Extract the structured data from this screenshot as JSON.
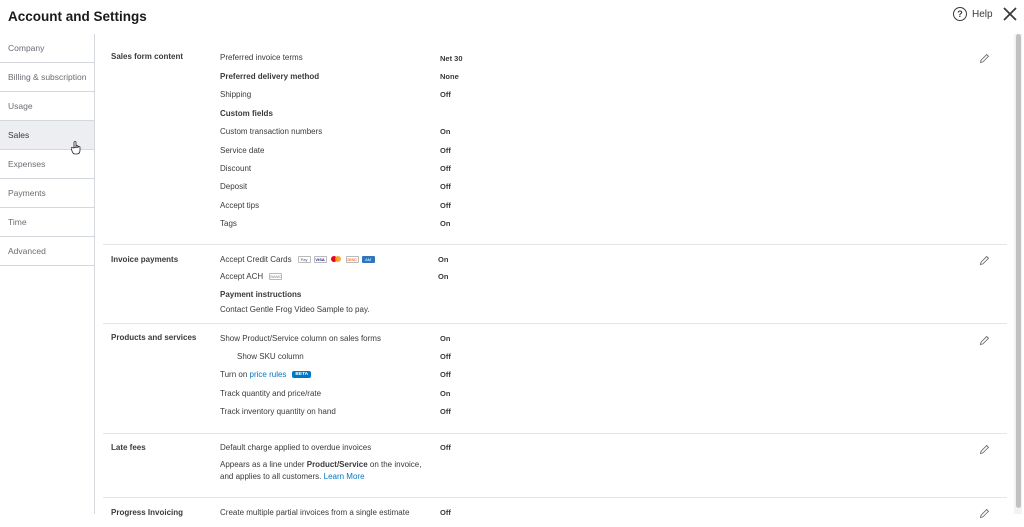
{
  "header": {
    "title": "Account and Settings",
    "help_label": "Help"
  },
  "sidebar": {
    "items": [
      {
        "label": "Company"
      },
      {
        "label": "Billing & subscription"
      },
      {
        "label": "Usage"
      },
      {
        "label": "Sales"
      },
      {
        "label": "Expenses"
      },
      {
        "label": "Payments"
      },
      {
        "label": "Time"
      },
      {
        "label": "Advanced"
      }
    ],
    "active": "Sales"
  },
  "sales_form": {
    "title": "Sales form content",
    "rows": [
      {
        "label": "Preferred invoice terms",
        "value": "Net 30"
      },
      {
        "label": "Preferred delivery method",
        "value": "None"
      },
      {
        "label": "Shipping",
        "value": "Off"
      },
      {
        "label": "Custom fields",
        "value": ""
      },
      {
        "label": "Custom transaction numbers",
        "value": "On"
      },
      {
        "label": "Service date",
        "value": "Off"
      },
      {
        "label": "Discount",
        "value": "Off"
      },
      {
        "label": "Deposit",
        "value": "Off"
      },
      {
        "label": "Accept tips",
        "value": "Off"
      },
      {
        "label": "Tags",
        "value": "On"
      }
    ]
  },
  "invoice_payments": {
    "title": "Invoice payments",
    "credit_label": "Accept Credit Cards",
    "credit_value": "On",
    "cards": {
      "applepay": "Pay",
      "visa": "VISA",
      "discover": "DISC",
      "amex": "AM"
    },
    "ach_label": "Accept ACH",
    "ach_value": "On",
    "ach_badge": "BANK",
    "instructions_label": "Payment instructions",
    "instructions_text": "Contact Gentle Frog Video Sample to pay."
  },
  "products": {
    "title": "Products and services",
    "show_column_label": "Show Product/Service column on sales forms",
    "show_column_value": "On",
    "sku_label": "Show SKU column",
    "sku_value": "Off",
    "price_rules_prefix": "Turn on",
    "price_rules_link": "price rules",
    "price_rules_badge": "BETA",
    "price_rules_value": "Off",
    "track_qty_label": "Track quantity and price/rate",
    "track_qty_value": "On",
    "track_inv_label": "Track inventory quantity on hand",
    "track_inv_value": "Off"
  },
  "late_fees": {
    "title": "Late fees",
    "default_label": "Default charge applied to overdue invoices",
    "default_value": "Off",
    "desc_1": "Appears as a line under",
    "desc_bold": "Product/Service",
    "desc_2": "on the invoice,",
    "desc_3": "and applies to all customers.",
    "learn_more": "Learn More"
  },
  "progress": {
    "title": "Progress Invoicing",
    "label": "Create multiple partial invoices from a single estimate",
    "value": "Off"
  }
}
